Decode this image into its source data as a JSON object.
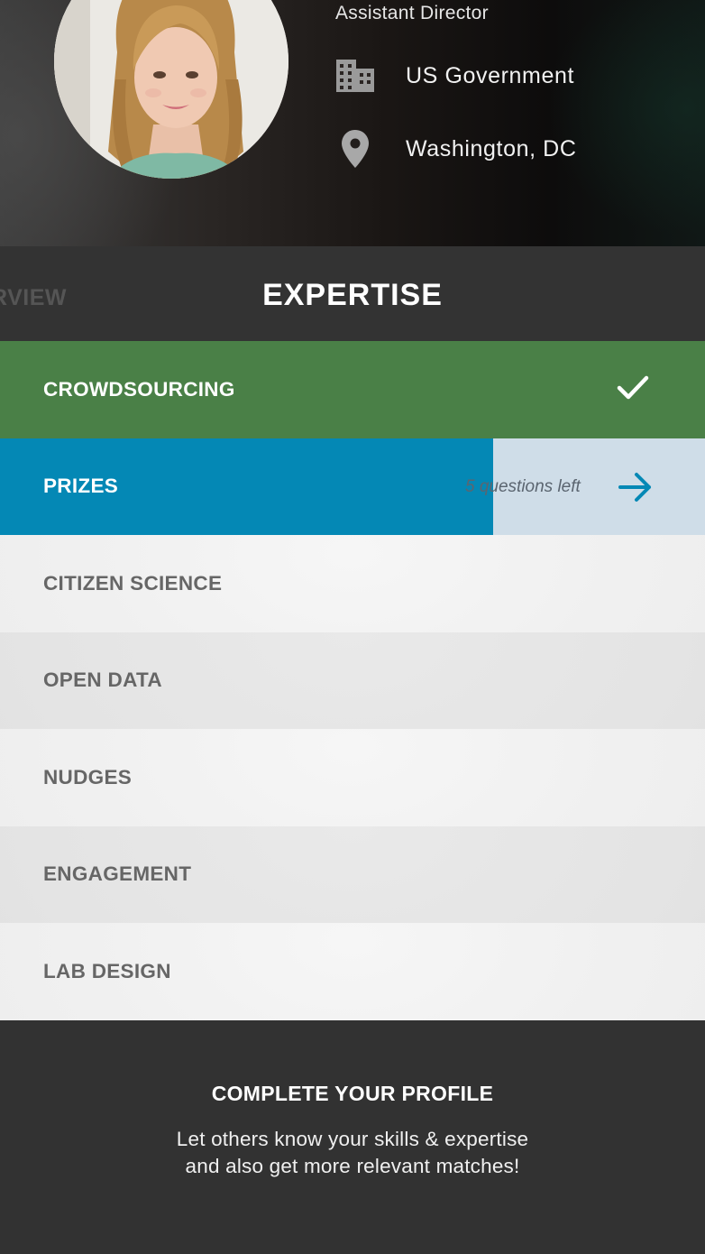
{
  "profile": {
    "job_title": "Assistant Director",
    "organization": "US Government",
    "location": "Washington, DC",
    "org_icon": "building-icon",
    "location_icon": "map-pin-icon"
  },
  "tabs": {
    "previous_tab_partial": "RVIEW",
    "active_tab": "EXPERTISE"
  },
  "expertise": {
    "items": [
      {
        "label": "CROWDSOURCING",
        "state": "completed",
        "icon": "checkmark-icon"
      },
      {
        "label": "PRIZES",
        "state": "in-progress",
        "progress": 0.7,
        "status_text": "5 questions left",
        "icon": "arrow-right-icon"
      },
      {
        "label": "CITIZEN SCIENCE",
        "state": "not-started"
      },
      {
        "label": "OPEN DATA",
        "state": "not-started"
      },
      {
        "label": "NUDGES",
        "state": "not-started"
      },
      {
        "label": "ENGAGEMENT",
        "state": "not-started"
      },
      {
        "label": "LAB DESIGN",
        "state": "not-started"
      }
    ]
  },
  "cta": {
    "title": "COMPLETE YOUR PROFILE",
    "line1": "Let others know your skills & expertise",
    "line2": "and also get more relevant matches!"
  },
  "colors": {
    "completed": "#4a8047",
    "in_progress": "#0488b5",
    "in_progress_track": "#cfdde8",
    "dark_bar": "#333333"
  }
}
